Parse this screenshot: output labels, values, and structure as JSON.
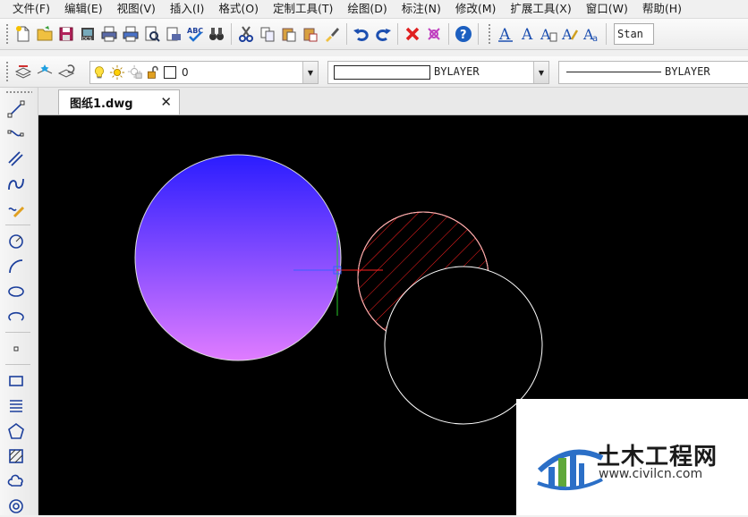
{
  "menu": [
    "文件(F)",
    "编辑(E)",
    "视图(V)",
    "插入(I)",
    "格式(O)",
    "定制工具(T)",
    "绘图(D)",
    "标注(N)",
    "修改(M)",
    "扩展工具(X)",
    "窗口(W)",
    "帮助(H)"
  ],
  "toolbar": {
    "text_style_value": "Stan"
  },
  "properties": {
    "layer_name": "0",
    "color_value": "BYLAYER",
    "linetype_value": "BYLAYER"
  },
  "tab": {
    "label": "图纸1.dwg",
    "close_glyph": "✕"
  },
  "watermark": {
    "title": "土木工程网",
    "url": "www.civilcn.com"
  },
  "colors": {
    "accent_blue": "#2b6fc7",
    "gradient_top": "#2a1cff",
    "gradient_bottom": "#e07cff",
    "hatch_red": "#ff2020"
  }
}
